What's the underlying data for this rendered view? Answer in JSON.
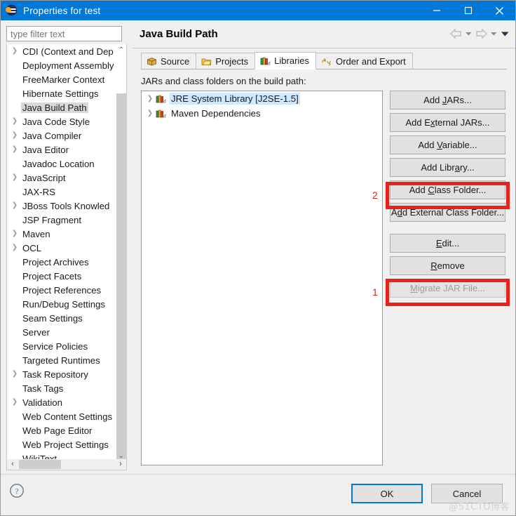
{
  "window": {
    "title": "Properties for test",
    "icon": "eclipse-logo-icon",
    "minimize_label": "—",
    "maximize_label": "☐",
    "close_label": "✕",
    "titlebar_color": "#0078d7"
  },
  "sidebar": {
    "filter": {
      "placeholder": "type filter text",
      "value": ""
    },
    "selected": "Java Build Path",
    "items": [
      {
        "label": "CDI (Context and Dep",
        "expandable": true
      },
      {
        "label": "Deployment Assembly",
        "expandable": false
      },
      {
        "label": "FreeMarker Context",
        "expandable": false
      },
      {
        "label": "Hibernate Settings",
        "expandable": false
      },
      {
        "label": "Java Build Path",
        "expandable": false,
        "selected": true
      },
      {
        "label": "Java Code Style",
        "expandable": true
      },
      {
        "label": "Java Compiler",
        "expandable": true
      },
      {
        "label": "Java Editor",
        "expandable": true
      },
      {
        "label": "Javadoc Location",
        "expandable": false
      },
      {
        "label": "JavaScript",
        "expandable": true
      },
      {
        "label": "JAX-RS",
        "expandable": false
      },
      {
        "label": "JBoss Tools Knowled",
        "expandable": true
      },
      {
        "label": "JSP Fragment",
        "expandable": false
      },
      {
        "label": "Maven",
        "expandable": true
      },
      {
        "label": "OCL",
        "expandable": true
      },
      {
        "label": "Project Archives",
        "expandable": false
      },
      {
        "label": "Project Facets",
        "expandable": false
      },
      {
        "label": "Project References",
        "expandable": false
      },
      {
        "label": "Run/Debug Settings",
        "expandable": false
      },
      {
        "label": "Seam Settings",
        "expandable": false
      },
      {
        "label": "Server",
        "expandable": false
      },
      {
        "label": "Service Policies",
        "expandable": false
      },
      {
        "label": "Targeted Runtimes",
        "expandable": false
      },
      {
        "label": "Task Repository",
        "expandable": true
      },
      {
        "label": "Task Tags",
        "expandable": false
      },
      {
        "label": "Validation",
        "expandable": true
      },
      {
        "label": "Web Content Settings",
        "expandable": false
      },
      {
        "label": "Web Page Editor",
        "expandable": false
      },
      {
        "label": "Web Project Settings",
        "expandable": false
      },
      {
        "label": "WikiText",
        "expandable": false
      }
    ],
    "scroll_up": "⌃",
    "scroll_down": "⌄",
    "scroll_left": "‹",
    "scroll_right": "›"
  },
  "main": {
    "page_title": "Java Build Path",
    "nav": {
      "back": "back-arrow-icon",
      "back_menu": "▼",
      "forward": "forward-arrow-icon",
      "forward_menu": "▼",
      "view_menu": "▼"
    },
    "tabs": [
      {
        "label": "Source",
        "icon": "source-package-icon",
        "active": false
      },
      {
        "label": "Projects",
        "icon": "folder-icon",
        "active": false
      },
      {
        "label": "Libraries",
        "icon": "library-books-icon",
        "active": true
      },
      {
        "label": "Order and Export",
        "icon": "order-export-icon",
        "active": false
      }
    ],
    "list_label": "JARs and class folders on the build path:",
    "entries": [
      {
        "label": "JRE System Library [J2SE-1.5]",
        "icon": "library-books-icon",
        "expandable": true,
        "selected": true
      },
      {
        "label": "Maven Dependencies",
        "icon": "library-books-icon",
        "expandable": true,
        "selected": false
      }
    ],
    "buttons": [
      {
        "label": "Add JARs...",
        "mnemonic": "J",
        "disabled": false,
        "group": 1
      },
      {
        "label": "Add External JARs...",
        "mnemonic": "x",
        "disabled": false,
        "group": 1
      },
      {
        "label": "Add Variable...",
        "mnemonic": "V",
        "disabled": false,
        "group": 1
      },
      {
        "label": "Add Library...",
        "mnemonic": "a",
        "disabled": false,
        "group": 1,
        "annotation": "2"
      },
      {
        "label": "Add Class Folder...",
        "mnemonic": "C",
        "disabled": false,
        "group": 1
      },
      {
        "label": "Add External Class Folder...",
        "mnemonic": "d",
        "disabled": false,
        "group": 1
      },
      {
        "label": "Edit...",
        "mnemonic": "E",
        "disabled": false,
        "group": 2
      },
      {
        "label": "Remove",
        "mnemonic": "R",
        "disabled": false,
        "group": 2,
        "annotation": "1"
      },
      {
        "label": "Migrate JAR File...",
        "mnemonic": "M",
        "disabled": true,
        "group": 2
      }
    ]
  },
  "annotations": {
    "color": "#e8211b",
    "marker_1": "1",
    "marker_2": "2"
  },
  "footer": {
    "help": "help-icon",
    "ok_label": "OK",
    "cancel_label": "Cancel",
    "watermark": "@51CTO博客"
  }
}
